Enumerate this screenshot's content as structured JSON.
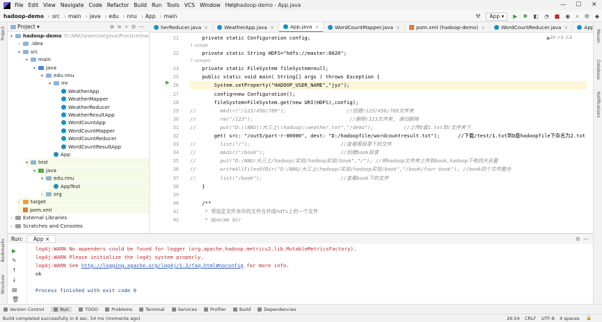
{
  "menu": {
    "items": [
      "File",
      "Edit",
      "View",
      "Navigate",
      "Code",
      "Refactor",
      "Build",
      "Run",
      "Tools",
      "VCS",
      "Window",
      "Help"
    ],
    "title": "hadoop-demo - App.java"
  },
  "nav": {
    "crumbs": [
      "hadoop-demo",
      "src",
      "main",
      "java",
      "edu",
      "nnu",
      "App",
      "main"
    ],
    "run_config": "App"
  },
  "project": {
    "header": "Project",
    "tree": [
      {
        "label": "hadoop-demo",
        "extra": "D:\\NNU\\exercise\\Java\\Practice\\hadoo",
        "icon": "folder",
        "indent": 0,
        "arrow": "▾",
        "bold": true
      },
      {
        "label": ".idea",
        "icon": "folder",
        "indent": 1,
        "arrow": "›"
      },
      {
        "label": "src",
        "icon": "folder",
        "indent": 1,
        "arrow": "▾"
      },
      {
        "label": "main",
        "icon": "folder",
        "indent": 2,
        "arrow": "▾"
      },
      {
        "label": "java",
        "icon": "folder-blue",
        "indent": 3,
        "arrow": "▾"
      },
      {
        "label": "edu.nnu",
        "icon": "folder",
        "indent": 4,
        "arrow": "▾"
      },
      {
        "label": "mr",
        "icon": "folder",
        "indent": 5,
        "arrow": "▾"
      },
      {
        "label": "WeatherApp",
        "icon": "class",
        "indent": 6
      },
      {
        "label": "WeatherMapper",
        "icon": "class",
        "indent": 6
      },
      {
        "label": "WeatherReducer",
        "icon": "class",
        "indent": 6
      },
      {
        "label": "WeatherResultApp",
        "icon": "class",
        "indent": 6
      },
      {
        "label": "WordCountApp",
        "icon": "class",
        "indent": 6
      },
      {
        "label": "WordCountMapper",
        "icon": "class",
        "indent": 6
      },
      {
        "label": "WordCountReducer",
        "icon": "class",
        "indent": 6
      },
      {
        "label": "WordCountResultApp",
        "icon": "class",
        "indent": 6
      },
      {
        "label": "App",
        "icon": "class",
        "indent": 5
      },
      {
        "label": "test",
        "icon": "folder",
        "indent": 2,
        "arrow": "▾"
      },
      {
        "label": "java",
        "icon": "folder-green",
        "indent": 3,
        "arrow": "▾"
      },
      {
        "label": "edu.nnu",
        "icon": "folder",
        "indent": 4,
        "arrow": "▾"
      },
      {
        "label": "AppTest",
        "icon": "class",
        "indent": 5
      },
      {
        "label": "org",
        "icon": "folder",
        "indent": 4,
        "arrow": "›"
      },
      {
        "label": "target",
        "icon": "folder-orange",
        "indent": 1,
        "arrow": "›"
      },
      {
        "label": "pom.xml",
        "icon": "xml",
        "indent": 1
      },
      {
        "label": "External Libraries",
        "icon": "lib",
        "indent": 0,
        "arrow": "›"
      },
      {
        "label": "Scratches and Consoles",
        "icon": "lib",
        "indent": 0,
        "arrow": "›"
      }
    ]
  },
  "tabs": [
    {
      "label": "herReducer.java"
    },
    {
      "label": "WeatherApp.java"
    },
    {
      "label": "App.java",
      "active": true
    },
    {
      "label": "WordCountMapper.java"
    },
    {
      "label": "pom.xml (hadoop-demo)"
    },
    {
      "label": "WordCountReducer.java"
    },
    {
      "label": "AppTest.java"
    }
  ],
  "editor": {
    "inspection": "▲20  ✓2  ⚠3",
    "lines": [
      {
        "n": "21",
        "kind": "code",
        "text": "    private static Configuration config;"
      },
      {
        "n": "",
        "kind": "hint",
        "text": "1 usage"
      },
      {
        "n": "22",
        "kind": "code",
        "text": "    private static String HDFS=\"hdfs://master:8020\";"
      },
      {
        "n": "",
        "kind": "hint",
        "text": "7 usages"
      },
      {
        "n": "23",
        "kind": "code",
        "text": "    private static FileSystem fileSystem=null;"
      },
      {
        "n": "25",
        "kind": "code",
        "text": "    public static void main( String[] args ) throws Exception {"
      },
      {
        "n": "26",
        "kind": "code",
        "text": "        System.setProperty(\"HADOOP_USER_NAME\",\"jyz\");"
      },
      {
        "n": "27",
        "kind": "code",
        "text": "        config=new Configuration();"
      },
      {
        "n": "28",
        "kind": "code",
        "text": "        fileSystem=FileSystem.get(new URI(HDFS),config);"
      },
      {
        "n": "29",
        "kind": "cmt",
        "text": "//        mkdir(\"/123/456/789\");                    //创建/123/456/789文件夹"
      },
      {
        "n": "30",
        "kind": "cmt",
        "text": "//        rm(\"/123\");                                //删除/123文件夹, 递归删除"
      },
      {
        "n": "31",
        "kind": "cmt",
        "text": "//        put(\"D:\\\\NNU\\\\大三上\\\\hadoop\\\\weather.txt\",\"/demo\");          //上传D盘1.txt到/文件夹下"
      },
      {
        "n": "32",
        "kind": "code",
        "text": "        get( src: \"/out5/part-r-00000\", dest: \"D:/hadoopfile/wordcountresult.txt\");      //下载/test/1.txt到D盘hadoopfile下命名为2.txt"
      },
      {
        "n": "33",
        "kind": "cmt",
        "text": "//        list(\"/\");                              //查看根目录下的文件"
      },
      {
        "n": "34",
        "kind": "cmt",
        "text": "//        mkdir(\"/book\");                         //创建book目录"
      },
      {
        "n": "35",
        "kind": "cmt",
        "text": "//        put(\"D:/NNU/大三上/hadoop/实验/hadoop实验/book\",\"/\"); //将hadoop文件夹上传到book,hadoop下有四大名著"
      },
      {
        "n": "36",
        "kind": "cmt",
        "text": "//        writeAllFilesOfDir(\"D:/NNU/大三上/hadoop/实验/hadoop实验/book\",\"/book/four-book\"); //book四个文件整合"
      },
      {
        "n": "37",
        "kind": "cmt",
        "text": "//        list(\"/book\");                          //查看book下的文件"
      },
      {
        "n": "38",
        "kind": "code",
        "text": "    }"
      },
      {
        "n": "39",
        "kind": "code",
        "text": ""
      },
      {
        "n": "40",
        "kind": "code",
        "text": "    /**"
      },
      {
        "n": "41",
        "kind": "doc",
        "text": "     * 将指定文件夹中的文件合并成hdfs上的一个文件"
      },
      {
        "n": "42",
        "kind": "doc",
        "text": "     * @param dir"
      }
    ]
  },
  "run": {
    "label": "Run:",
    "config": "App",
    "lines": [
      {
        "text": "log4j:WARN No appenders could be found for logger (org.apache.hadoop.metrics2.lib.MutableMetricsFactory).",
        "red": true
      },
      {
        "text": "log4j:WARN Please initialize the log4j system properly.",
        "red": true
      },
      {
        "pre": "log4j:WARN See ",
        "link": "http://logging.apache.org/log4j/1.2/faq.html#noconfig",
        "post": " for more info.",
        "red": true
      },
      {
        "text": "ok",
        "red": false
      },
      {
        "text": "",
        "red": false
      },
      {
        "text": "Process finished with exit code 0",
        "red": false,
        "blue": true
      }
    ]
  },
  "bottom_tabs": [
    "Version Control",
    "Run",
    "TODO",
    "Problems",
    "Terminal",
    "Services",
    "Profiler",
    "Build",
    "Dependencies"
  ],
  "status": {
    "message": "Build completed successfully in 6 sec, 54 ms (moments ago)",
    "pos": "26:54",
    "eol": "CRLF",
    "enc": "UTF-8",
    "indent": "4 spaces"
  },
  "sidebar_left": [
    "Project",
    "Bookmarks",
    "Structure"
  ],
  "sidebar_right": [
    "Maven",
    "Database",
    "Notifications"
  ]
}
